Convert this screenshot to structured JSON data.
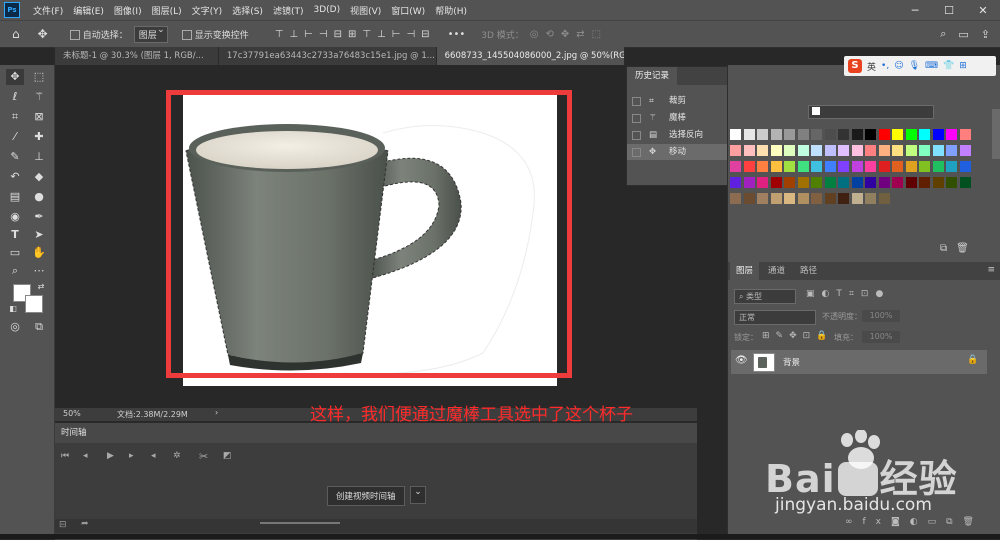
{
  "menu": {
    "logo": "Ps",
    "items": [
      "文件(F)",
      "编辑(E)",
      "图像(I)",
      "图层(L)",
      "文字(Y)",
      "选择(S)",
      "滤镜(T)",
      "3D(D)",
      "视图(V)",
      "窗口(W)",
      "帮助(H)"
    ],
    "min": "─",
    "max": "☐",
    "close": "✕"
  },
  "options": {
    "auto_select_label": "自动选择：",
    "auto_select_target": "图层",
    "show_transform_label": "显示变换控件",
    "more": "•••",
    "mode_3d": "3D 模式："
  },
  "tabs": [
    {
      "label": "未标题-1 @ 30.3% (图层 1, RGB/..."
    },
    {
      "label": "17c37791ea63443c2733a76483c15e1.jpg @ 1..."
    },
    {
      "label": "6608733_145504086000_2.jpg @ 50%(RGB/8..."
    }
  ],
  "history": {
    "title": "历史记录",
    "items": [
      {
        "label": "裁剪",
        "icon": "crop-icon"
      },
      {
        "label": "魔棒",
        "icon": "magic-wand-icon"
      },
      {
        "label": "选择反向",
        "icon": "document-icon"
      },
      {
        "label": "移动",
        "icon": "move-icon"
      }
    ]
  },
  "status": {
    "zoom": "50%",
    "doc_info": "文档:2.38M/2.29M",
    "arrow": "›"
  },
  "annotation": "这样，我们便通过魔棒工具选中了这个杯子",
  "timeline": {
    "title": "时间轴",
    "create_button": "创建视频时间轴",
    "create_dd": "⌄"
  },
  "sogou": {
    "logo": "S",
    "lang": "英"
  },
  "layers": {
    "tabs": [
      "图层",
      "通道",
      "路径"
    ],
    "filter_label": "类型",
    "blend_mode": "正常",
    "opacity_label": "不透明度：",
    "opacity_value": "100%",
    "lock_label": "锁定：",
    "fill_label": "填充：",
    "fill_value": "100%",
    "layer_name": "背景"
  },
  "watermark": {
    "brand": "Bai",
    "brand2": "经验",
    "url": "jingyan.baidu.com"
  },
  "colors": {
    "selection_box": "#ee3b3b",
    "annotation": "#ff2b2b",
    "panel_bg": "#535353",
    "canvas_bg": "#282828"
  }
}
